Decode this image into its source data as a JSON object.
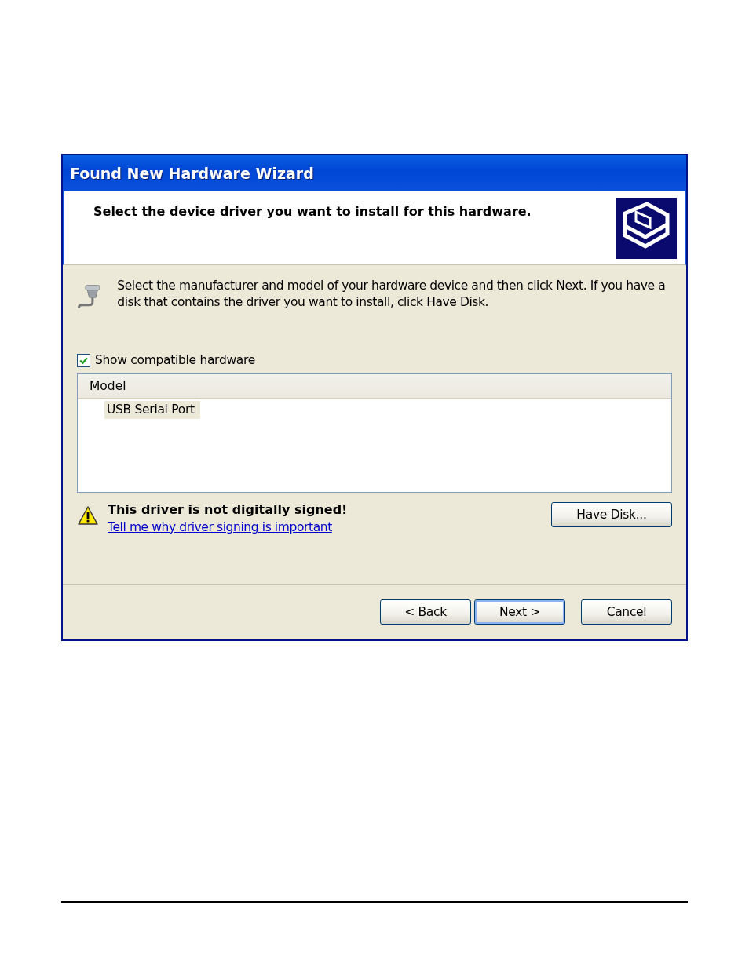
{
  "window": {
    "title": "Found New Hardware Wizard"
  },
  "header": {
    "heading": "Select the device driver you want to install for this hardware."
  },
  "intro": "Select the manufacturer and model of your hardware device and then click Next. If you have a disk that contains the driver you want to install, click Have Disk.",
  "compatible_checkbox": {
    "label": "Show compatible hardware",
    "checked": true
  },
  "model_list": {
    "column": "Model",
    "items": [
      {
        "label": "USB Serial Port",
        "selected": true
      }
    ]
  },
  "warning": {
    "text": "This driver is not digitally signed!",
    "link": "Tell me why driver signing is important"
  },
  "have_disk_button": "Have Disk...",
  "buttons": [
    {
      "label": "< Back",
      "default": false
    },
    {
      "label": "Next >",
      "default": true
    },
    {
      "label": "Cancel",
      "default": false
    }
  ]
}
